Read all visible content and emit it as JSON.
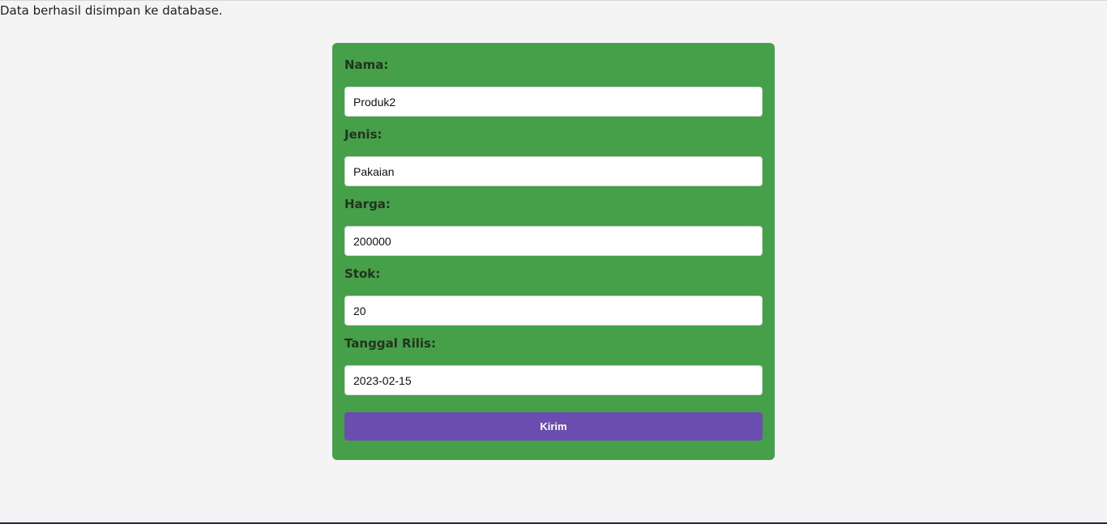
{
  "status": {
    "message": "Data berhasil disimpan ke database."
  },
  "form": {
    "fields": [
      {
        "label": "Nama:",
        "value": "Produk2"
      },
      {
        "label": "Jenis:",
        "value": "Pakaian"
      },
      {
        "label": "Harga:",
        "value": "200000"
      },
      {
        "label": "Stok:",
        "value": "20"
      },
      {
        "label": "Tanggal Rilis:",
        "value": "2023-02-15"
      }
    ],
    "submit_label": "Kirim"
  },
  "colors": {
    "page_background": "#f4f4f4",
    "card_background": "#46a04a",
    "button_background": "#6a4daf",
    "button_text": "#ffffff"
  }
}
